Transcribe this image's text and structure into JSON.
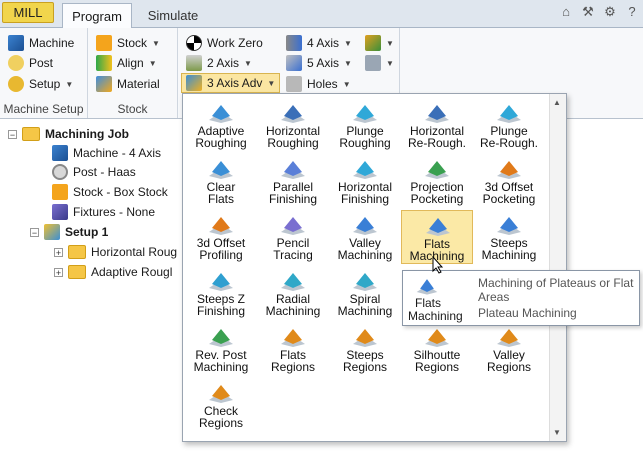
{
  "tabs": {
    "mill": "MILL",
    "program": "Program",
    "simulate": "Simulate"
  },
  "quick_access": [
    "home-icon",
    "hammer-icon",
    "gear-icon",
    "help-icon"
  ],
  "ribbon": {
    "machine_setup": {
      "label": "Machine Setup",
      "machine": "Machine",
      "post": "Post",
      "setup": "Setup"
    },
    "stock": {
      "label": "Stock",
      "stock": "Stock",
      "align": "Align",
      "material": "Material"
    },
    "toolpath": {
      "work_zero": "Work Zero",
      "two_axis": "2 Axis",
      "three_axis_adv": "3 Axis Adv",
      "four_axis": "4 Axis",
      "five_axis": "5 Axis",
      "holes": "Holes"
    }
  },
  "tree": {
    "root": "Machining Job",
    "machine": "Machine - 4 Axis",
    "post": "Post - Haas",
    "stock": "Stock - Box Stock",
    "fixtures": "Fixtures - None",
    "setup": "Setup 1",
    "op1": "Horizontal Roug",
    "op2": "Adaptive Rougl"
  },
  "gallery": [
    {
      "l1": "Adaptive",
      "l2": "Roughing",
      "color": "#3a8fd6"
    },
    {
      "l1": "Horizontal",
      "l2": "Roughing",
      "color": "#3a6fb8"
    },
    {
      "l1": "Plunge",
      "l2": "Roughing",
      "color": "#2fa8d8"
    },
    {
      "l1": "Horizontal",
      "l2": "Re-Rough.",
      "color": "#3a6fb8"
    },
    {
      "l1": "Plunge",
      "l2": "Re-Rough.",
      "color": "#2fa8d8"
    },
    {
      "l1": "Clear",
      "l2": "Flats",
      "color": "#3a8fd6"
    },
    {
      "l1": "Parallel",
      "l2": "Finishing",
      "color": "#5a7fd8"
    },
    {
      "l1": "Horizontal",
      "l2": "Finishing",
      "color": "#2fa8d8"
    },
    {
      "l1": "Projection",
      "l2": "Pocketing",
      "color": "#3aa050"
    },
    {
      "l1": "3d Offset",
      "l2": "Pocketing",
      "color": "#e07a1a"
    },
    {
      "l1": "3d Offset",
      "l2": "Profiling",
      "color": "#e07a1a"
    },
    {
      "l1": "Pencil",
      "l2": "Tracing",
      "color": "#7a6fd0"
    },
    {
      "l1": "Valley",
      "l2": "Machining",
      "color": "#3a7fd6"
    },
    {
      "l1": "Flats",
      "l2": "Machining",
      "color": "#3a7fd6"
    },
    {
      "l1": "Steeps",
      "l2": "Machining",
      "color": "#3a7fd6"
    },
    {
      "l1": "Steeps Z",
      "l2": "Finishing",
      "color": "#2f9fd0"
    },
    {
      "l1": "Radial",
      "l2": "Machining",
      "color": "#2fa8c8"
    },
    {
      "l1": "Spiral",
      "l2": "Machining",
      "color": "#2fa8c8"
    },
    {
      "l1": "",
      "l2": "",
      "color": "#3a7fd6"
    },
    {
      "l1": "",
      "l2": "",
      "color": "#3a7fd6"
    },
    {
      "l1": "Rev. Post",
      "l2": "Machining",
      "color": "#3aa050"
    },
    {
      "l1": "Flats",
      "l2": "Regions",
      "color": "#e08a1a"
    },
    {
      "l1": "Steeps",
      "l2": "Regions",
      "color": "#e08a1a"
    },
    {
      "l1": "Silhoutte",
      "l2": "Regions",
      "color": "#e08a1a"
    },
    {
      "l1": "Valley",
      "l2": "Regions",
      "color": "#e08a1a"
    },
    {
      "l1": "Check",
      "l2": "Regions",
      "color": "#e08a1a"
    }
  ],
  "tooltip": {
    "title_l1": "Flats",
    "title_l2": "Machining",
    "description": "Machining of Plateaus or Flat Areas",
    "subtitle": "Plateau Machining"
  }
}
